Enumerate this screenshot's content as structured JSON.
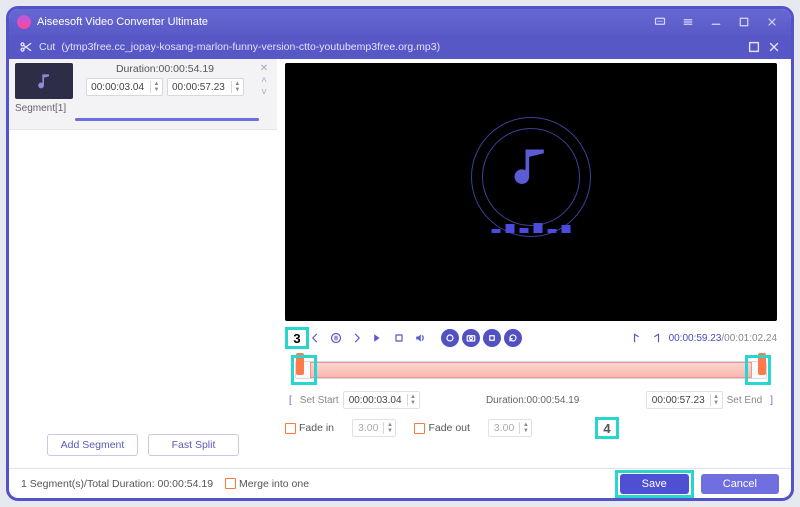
{
  "app": {
    "title": "Aiseesoft Video Converter Ultimate"
  },
  "subheader": {
    "mode": "Cut",
    "filename": "(ytmp3free.cc_jopay-kosang-marlon-funny-version-ctto-youtubemp3free.org.mp3)"
  },
  "segment": {
    "duration_label": "Duration:00:00:54.19",
    "start": "00:00:03.04",
    "end": "00:00:57.23",
    "name": "Segment[1]"
  },
  "left_buttons": {
    "add": "Add Segment",
    "split": "Fast Split"
  },
  "playback": {
    "current": "00:00:59.23",
    "total": "00:01:02.24",
    "sep": "/"
  },
  "timeline": {
    "set_start": "Set Start",
    "start_val": "00:00:03.04",
    "duration_label": "Duration:00:00:54.19",
    "end_val": "00:00:57.23",
    "set_end": "Set End"
  },
  "fade": {
    "in_label": "Fade in",
    "in_val": "3.00",
    "out_label": "Fade out",
    "out_val": "3.00"
  },
  "callouts": {
    "c3": "3",
    "c4": "4"
  },
  "footer": {
    "summary": "1 Segment(s)/Total Duration: 00:00:54.19",
    "merge": "Merge into one",
    "save": "Save",
    "cancel": "Cancel"
  }
}
